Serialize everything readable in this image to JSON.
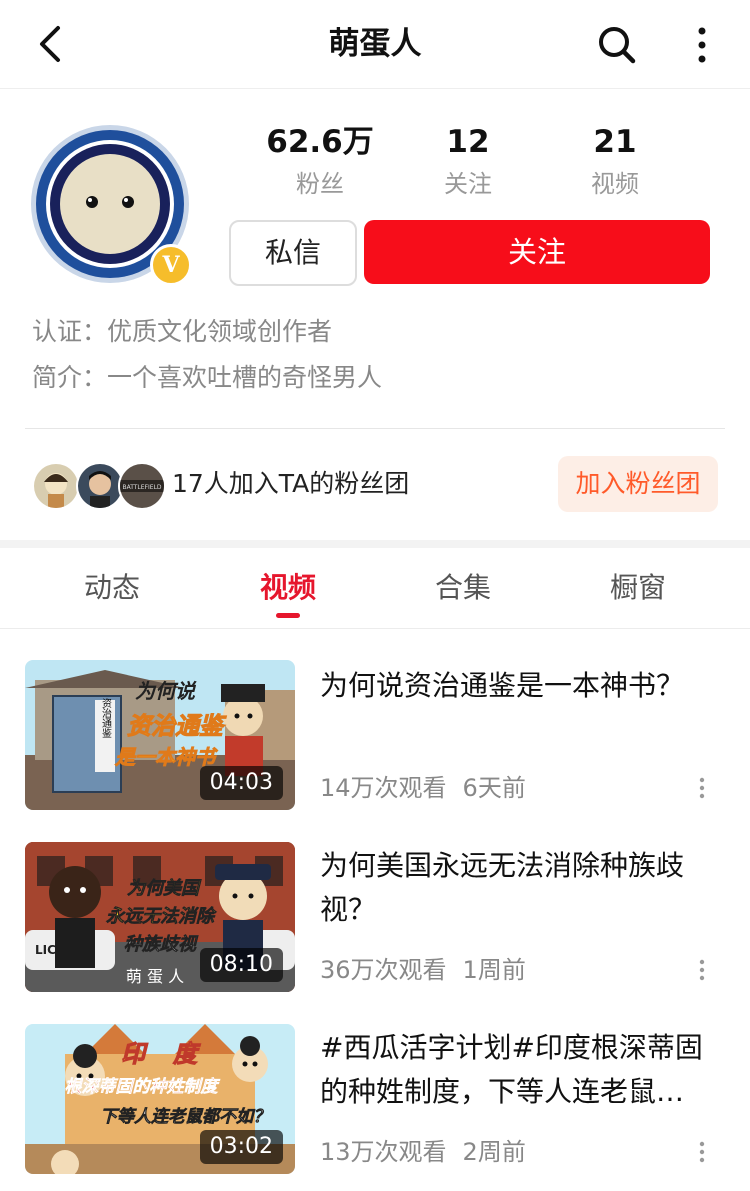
{
  "header": {
    "title": "萌蛋人",
    "back_icon": "chevron-left-icon",
    "search_icon": "search-icon",
    "more_icon": "more-vertical-icon"
  },
  "profile": {
    "badge_letter": "V",
    "stats": [
      {
        "value": "62.6万",
        "label": "粉丝"
      },
      {
        "value": "12",
        "label": "关注"
      },
      {
        "value": "21",
        "label": "视频"
      }
    ],
    "message_button": "私信",
    "follow_button": "关注",
    "verification": "认证：优质文化领域创作者",
    "bio": "简介：一个喜欢吐槽的奇怪男人"
  },
  "fan_club": {
    "text": "17人加入TA的粉丝团",
    "join_button": "加入粉丝团",
    "third_avatar_text": "BATTLEFIELD"
  },
  "tabs": [
    {
      "label": "动态",
      "active": false
    },
    {
      "label": "视频",
      "active": true
    },
    {
      "label": "合集",
      "active": false
    },
    {
      "label": "橱窗",
      "active": false
    }
  ],
  "videos": [
    {
      "title": "为何说资治通鉴是一本神书？",
      "views": "14万次观看",
      "time": "6天前",
      "duration": "04:03",
      "thumb_lines": [
        "为何说",
        "资治通鉴",
        "是一本神书"
      ],
      "book_title": "资治通鉴"
    },
    {
      "title": "为何美国永远无法消除种族歧视？",
      "views": "36万次观看",
      "time": "1周前",
      "duration": "08:10",
      "thumb_lines": [
        "为何美国",
        "永远无法消除",
        "种族歧视"
      ],
      "watermark": "萌 蛋 人",
      "car_text": "LICE"
    },
    {
      "title": "#西瓜活字计划#印度根深蒂固的种姓制度，下等人连老鼠…",
      "views": "13万次观看",
      "time": "2周前",
      "duration": "03:02",
      "thumb_lines": [
        "印",
        "度",
        "根深蒂固的种姓制度",
        "下等人连老鼠都不如？"
      ]
    }
  ],
  "colors": {
    "accent": "#f70d1a",
    "join_bg": "#fdeee6",
    "join_text": "#ff5a2a"
  }
}
